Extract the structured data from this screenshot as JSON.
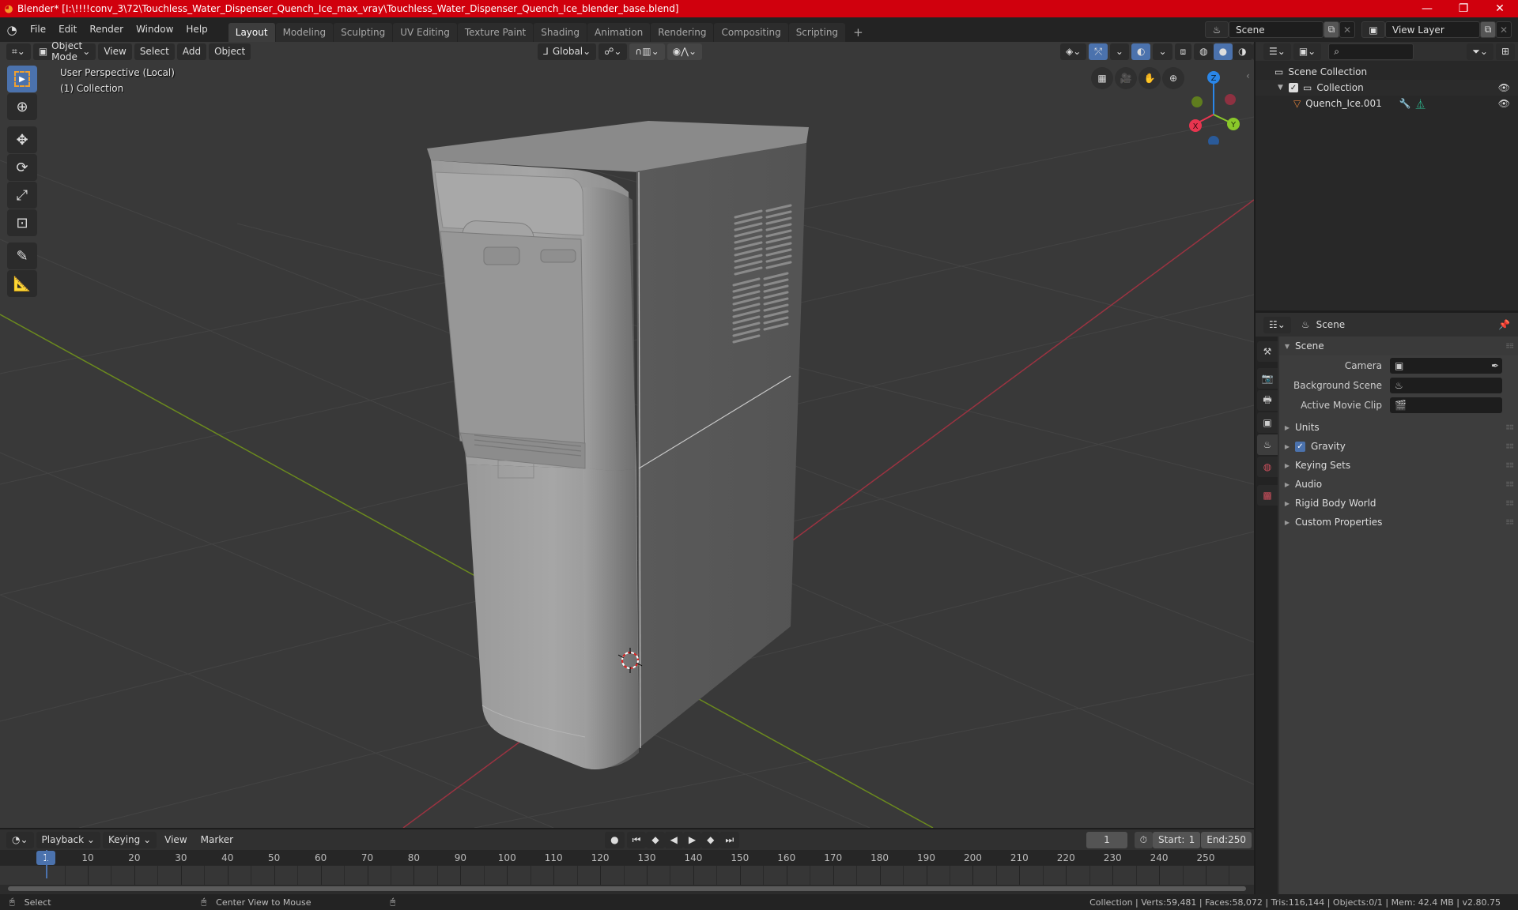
{
  "window": {
    "title": "Blender* [I:\\!!!!conv_3\\72\\Touchless_Water_Dispenser_Quench_Ice_max_vray\\Touchless_Water_Dispenser_Quench_Ice_blender_base.blend]",
    "controls": [
      "minimize",
      "maximize",
      "close"
    ]
  },
  "menubar": {
    "menus": [
      "File",
      "Edit",
      "Render",
      "Window",
      "Help"
    ],
    "workspaces": [
      "Layout",
      "Modeling",
      "Sculpting",
      "UV Editing",
      "Texture Paint",
      "Shading",
      "Animation",
      "Rendering",
      "Compositing",
      "Scripting"
    ],
    "active_workspace": "Layout",
    "add_workspace": "+",
    "scene": "Scene",
    "view_layer": "View Layer"
  },
  "viewport": {
    "mode": "Object Mode",
    "menus": [
      "View",
      "Select",
      "Add",
      "Object"
    ],
    "orientation": "Global",
    "overlay_line1": "User Perspective (Local)",
    "overlay_line2": "(1) Collection",
    "gizmo": {
      "z": "Z",
      "x": "X",
      "y": "Y"
    },
    "tools": [
      "select-box",
      "cursor",
      "move",
      "rotate",
      "scale",
      "transform",
      "annotate",
      "measure"
    ]
  },
  "outliner": {
    "search_placeholder": "",
    "root": "Scene Collection",
    "items": [
      {
        "label": "Collection",
        "checked": true,
        "visible": true
      },
      {
        "label": "Quench_Ice.001",
        "visible": true
      }
    ]
  },
  "properties": {
    "context": "Scene",
    "section": "Scene",
    "fields": [
      {
        "label": "Camera",
        "value": ""
      },
      {
        "label": "Background Scene",
        "value": ""
      },
      {
        "label": "Active Movie Clip",
        "value": ""
      }
    ],
    "panels": [
      {
        "label": "Units",
        "checkbox": false
      },
      {
        "label": "Gravity",
        "checkbox": true,
        "checked": true
      },
      {
        "label": "Keying Sets",
        "checkbox": false
      },
      {
        "label": "Audio",
        "checkbox": false
      },
      {
        "label": "Rigid Body World",
        "checkbox": false
      },
      {
        "label": "Custom Properties",
        "checkbox": false
      }
    ]
  },
  "timeline": {
    "menus": [
      "Playback",
      "Keying",
      "View",
      "Marker"
    ],
    "current_frame": "1",
    "start_label": "Start:",
    "start": "1",
    "end_label": "End:",
    "end": "250",
    "ticks": [
      "10",
      "20",
      "30",
      "40",
      "50",
      "60",
      "70",
      "80",
      "90",
      "100",
      "110",
      "120",
      "130",
      "140",
      "150",
      "160",
      "170",
      "180",
      "190",
      "200",
      "210",
      "220",
      "230",
      "240",
      "250"
    ]
  },
  "statusbar": {
    "left_action": "Select",
    "middle_action": "Center View to Mouse",
    "stats": "Collection | Verts:59,481 | Faces:58,072 | Tris:116,144 | Objects:0/1 | Mem: 42.4 MB | v2.80.75"
  },
  "colors": {
    "titlebar": "#d0000d",
    "accent": "#4b72ad",
    "axis_x": "#e8354f",
    "axis_y": "#8ac82a",
    "axis_z": "#2a86e8"
  }
}
